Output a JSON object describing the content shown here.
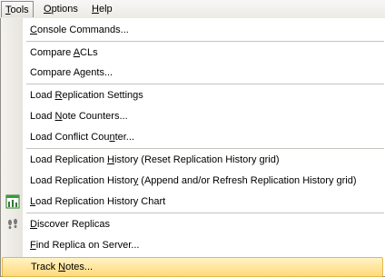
{
  "menubar": {
    "tools": {
      "pre": "",
      "key": "T",
      "post": "ools"
    },
    "options": {
      "pre": "",
      "key": "O",
      "post": "ptions"
    },
    "help": {
      "pre": "",
      "key": "H",
      "post": "elp"
    }
  },
  "menu": {
    "console_commands": {
      "pre": "",
      "key": "C",
      "post": "onsole Commands..."
    },
    "compare_acls": {
      "pre": "Compare ",
      "key": "A",
      "post": "CLs"
    },
    "compare_agents": {
      "pre": "Compare A",
      "key": "g",
      "post": "ents..."
    },
    "load_replication_settings": {
      "pre": "Load ",
      "key": "R",
      "post": "eplication Settings"
    },
    "load_note_counters": {
      "pre": "Load ",
      "key": "N",
      "post": "ote Counters..."
    },
    "load_conflict_counter": {
      "pre": "Load Conflict Cou",
      "key": "n",
      "post": "ter..."
    },
    "load_history_reset": {
      "pre": "Load Replication ",
      "key": "H",
      "post": "istory (Reset Replication History grid)"
    },
    "load_history_append": {
      "pre": "Load Replication Histor",
      "key": "y",
      "post": " (Append and/or Refresh Replication History grid)"
    },
    "load_history_chart": {
      "pre": "",
      "key": "L",
      "post": "oad Replication History Chart"
    },
    "discover_replicas": {
      "pre": "",
      "key": "D",
      "post": "iscover Replicas"
    },
    "find_replica": {
      "pre": "",
      "key": "F",
      "post": "ind Replica on Server..."
    },
    "track_notes": {
      "pre": "Track ",
      "key": "N",
      "post": "otes..."
    }
  },
  "icons": {
    "chart": "bar-chart-icon",
    "footprints": "footprints-icon"
  },
  "colors": {
    "highlight": "#ffd97a",
    "gutter": "#eceae4"
  }
}
